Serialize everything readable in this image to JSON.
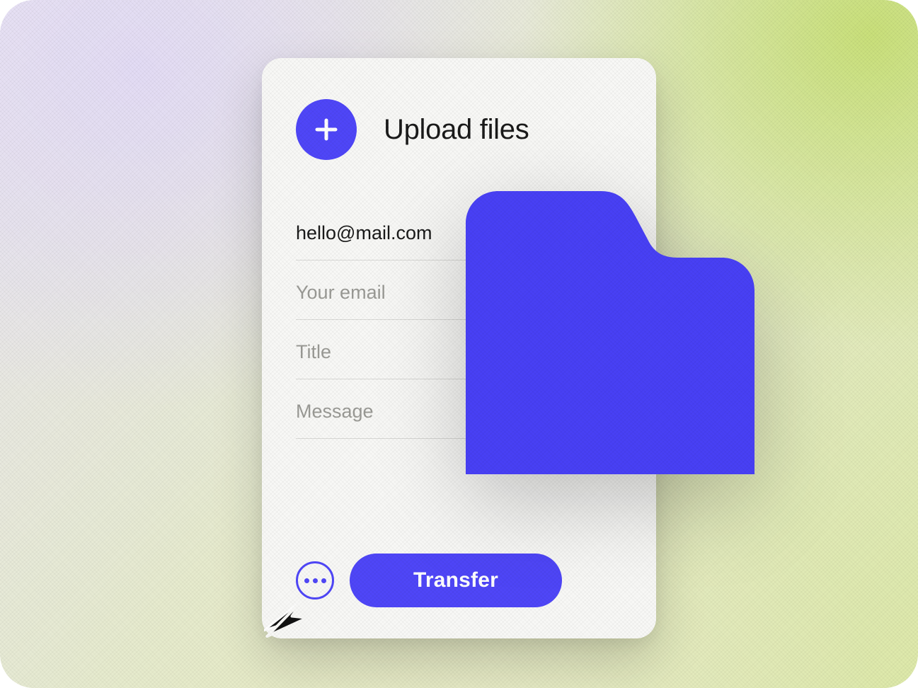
{
  "header": {
    "title": "Upload files"
  },
  "form": {
    "email_to_value": "hello@mail.com",
    "your_email_placeholder": "Your email",
    "title_placeholder": "Title",
    "message_placeholder": "Message"
  },
  "actions": {
    "transfer_label": "Transfer"
  },
  "colors": {
    "accent": "#4F46F8"
  }
}
